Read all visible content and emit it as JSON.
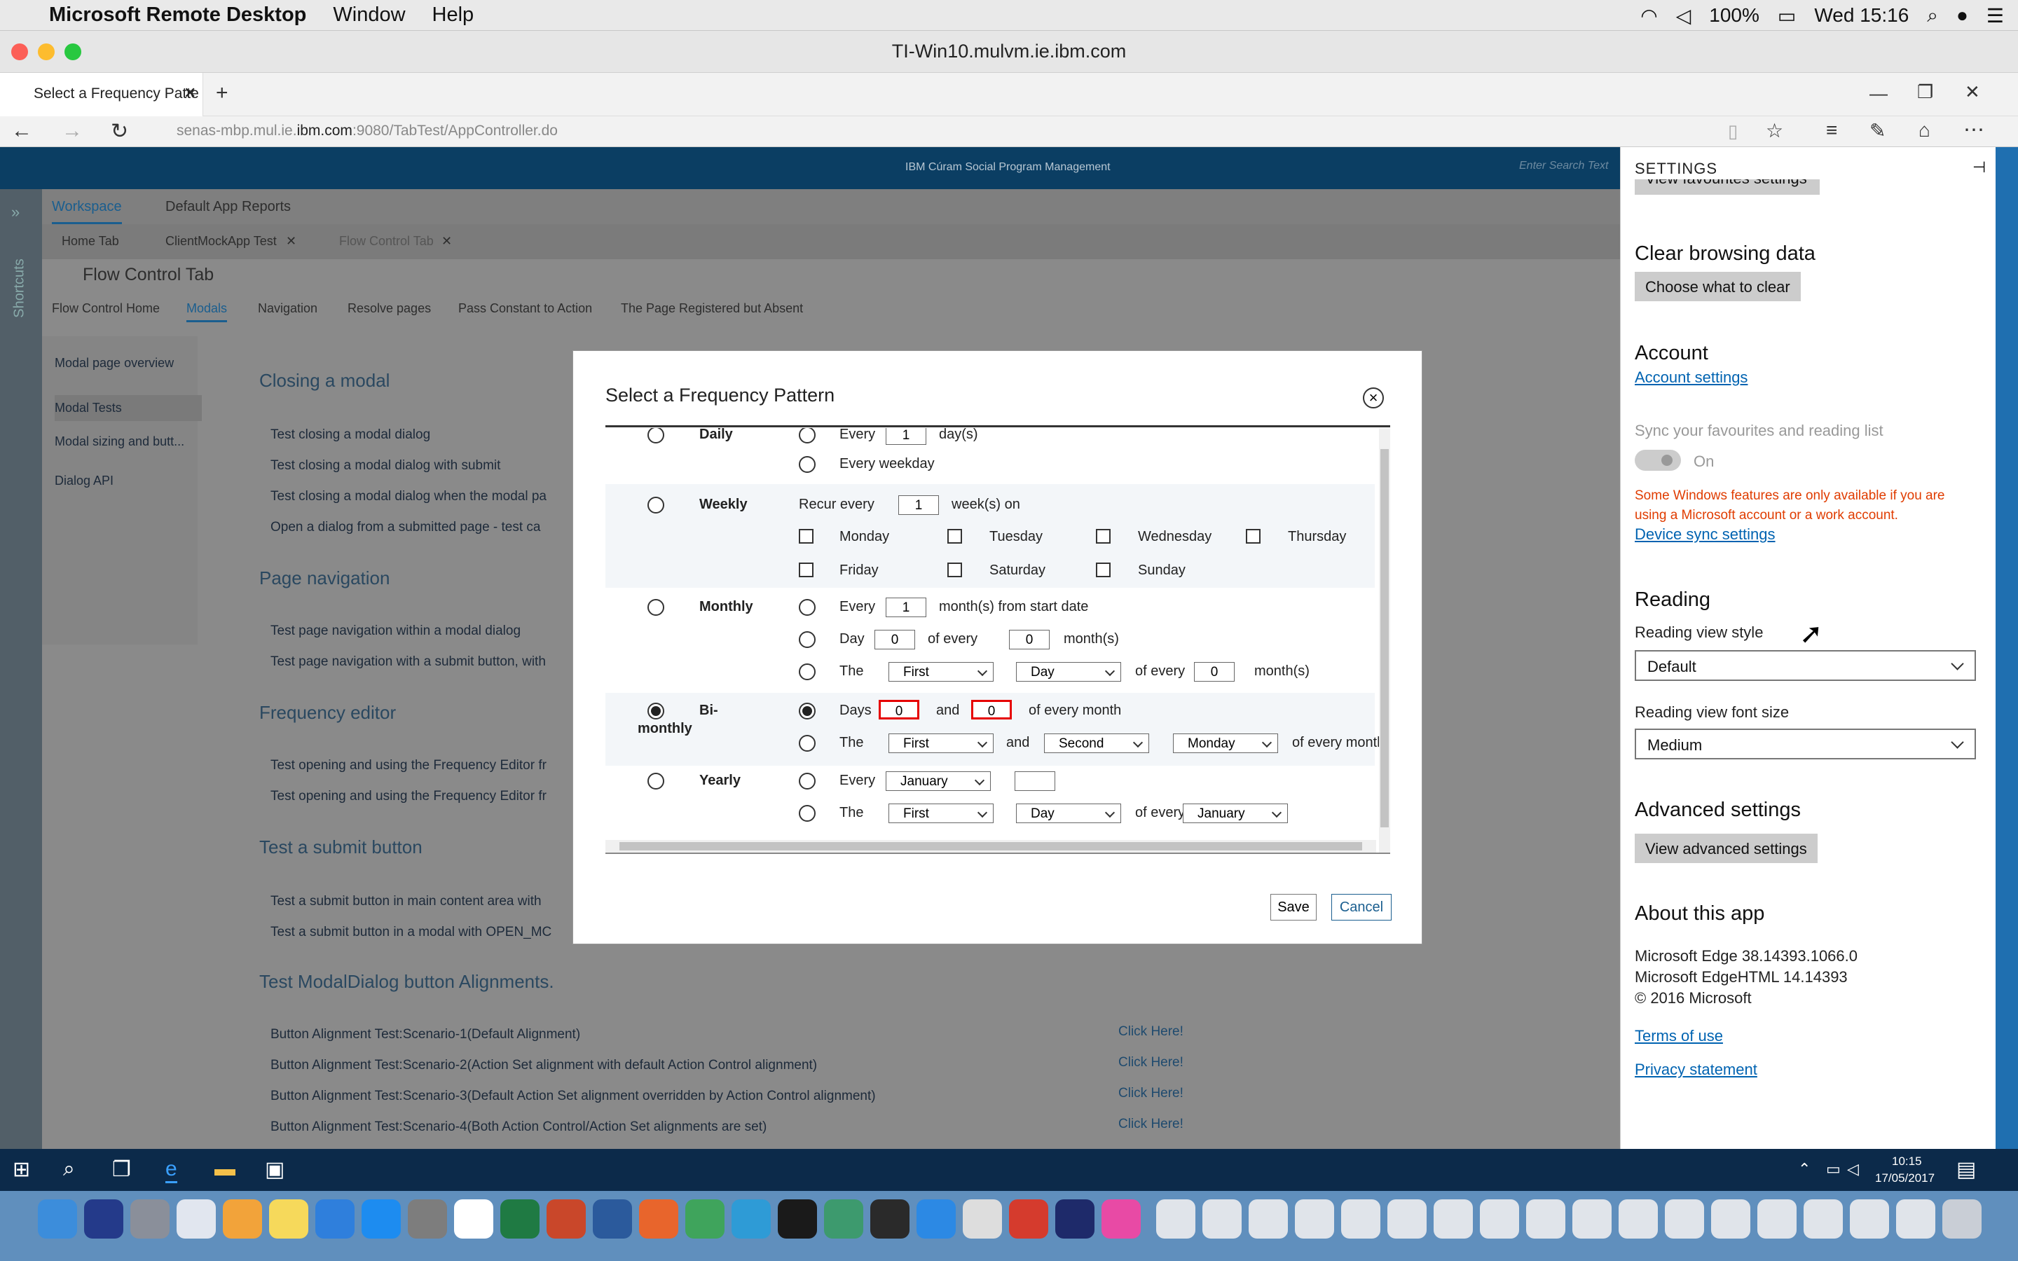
{
  "menubar": {
    "app": "Microsoft Remote Desktop",
    "menus": [
      "Window",
      "Help"
    ],
    "battery": "100%",
    "clock": "Wed 15:16"
  },
  "rdp": {
    "title": "TI-Win10.mulvm.ie.ibm.com"
  },
  "edge": {
    "tab_title": "Select a Frequency Patte",
    "url_prefix": "senas-mbp.mul.ie.",
    "url_domain": "ibm.com",
    "url_suffix": ":9080/TabTest/AppController.do"
  },
  "page": {
    "brand": "IBM Cúram Social Program Management",
    "search_placeholder": "Enter Search Text",
    "nav": [
      "Workspace",
      "Default App Reports"
    ],
    "tabs": [
      "Home Tab",
      "ClientMockApp Test",
      "Flow Control Tab"
    ],
    "shortcuts": "Shortcuts",
    "section_title": "Flow Control Tab",
    "subnav": [
      "Flow Control Home",
      "Modals",
      "Navigation",
      "Resolve pages",
      "Pass Constant to Action",
      "The Page Registered but Absent"
    ],
    "left_links": [
      "Modal page overview",
      "Modal Tests",
      "Modal sizing and butt...",
      "Dialog API"
    ],
    "headings": [
      "Closing a modal",
      "Page navigation",
      "Frequency editor",
      "Test a submit button",
      "Test ModalDialog button Alignments."
    ],
    "links_closing": [
      "Test closing a modal dialog",
      "Test closing a modal dialog with submit",
      "Test closing a modal dialog when the modal pa",
      "Open a dialog from a submitted page - test ca"
    ],
    "links_nav": [
      "Test page navigation within a modal dialog",
      "Test page navigation with a submit button, with"
    ],
    "links_freq": [
      "Test opening and using the Frequency Editor fr",
      "Test opening and using the Frequency Editor fr"
    ],
    "links_submit": [
      "Test a submit button in main content area with",
      "Test a submit button in a modal with OPEN_MC"
    ],
    "links_align": [
      "Button Alignment Test:Scenario-1(Default Alignment)",
      "Button Alignment Test:Scenario-2(Action Set alignment with default Action Control alignment)",
      "Button Alignment Test:Scenario-3(Default Action Set alignment overridden by Action Control alignment)",
      "Button Alignment Test:Scenario-4(Both Action Control/Action Set alignments are set)"
    ],
    "click_here": "Click Here!"
  },
  "modal": {
    "title": "Select a Frequency Pattern",
    "close": "×",
    "daily": {
      "label": "Daily",
      "every": "Every",
      "days_val": "1",
      "days_unit": "day(s)",
      "weekday": "Every weekday"
    },
    "weekly": {
      "label": "Weekly",
      "recur": "Recur every",
      "weeks_val": "1",
      "weeks_unit": "week(s) on",
      "days": [
        "Monday",
        "Tuesday",
        "Wednesday",
        "Thursday",
        "Friday",
        "Saturday",
        "Sunday"
      ]
    },
    "monthly": {
      "label": "Monthly",
      "every": "Every",
      "months_val": "1",
      "months_unit": "month(s) from start date",
      "day": "Day",
      "day_val": "0",
      "of_every": "of every",
      "of_every_val": "0",
      "months": "month(s)",
      "the": "The",
      "first": "First",
      "dayword": "Day",
      "the_val": "0"
    },
    "bimonthly": {
      "label1": "Bi-",
      "label2": "monthly",
      "days": "Days",
      "d1": "0",
      "and": "and",
      "d2": "0",
      "of_every_month": "of every month",
      "the": "The",
      "first": "First",
      "second": "Second",
      "monday": "Monday"
    },
    "yearly": {
      "label": "Yearly",
      "every": "Every",
      "month": "January",
      "the": "The",
      "first": "First",
      "dayword": "Day",
      "of_every": "of every",
      "month2": "January"
    },
    "save": "Save",
    "cancel": "Cancel"
  },
  "settings": {
    "title": "SETTINGS",
    "partial_button": "View favourites settings",
    "clear_heading": "Clear browsing data",
    "clear_button": "Choose what to clear",
    "account_heading": "Account",
    "account_link": "Account settings",
    "sync_label": "Sync your favourites and reading list",
    "sync_state": "On",
    "warning": "Some Windows features are only available if you are using a Microsoft account or a work account.",
    "device_sync": "Device sync settings",
    "reading_heading": "Reading",
    "reading_style_label": "Reading view style",
    "reading_style_value": "Default",
    "font_size_label": "Reading view font size",
    "font_size_value": "Medium",
    "advanced_heading": "Advanced settings",
    "advanced_button": "View advanced settings",
    "about_heading": "About this app",
    "about_lines": [
      "Microsoft Edge 38.14393.1066.0",
      "Microsoft EdgeHTML 14.14393",
      "© 2016 Microsoft"
    ],
    "terms": "Terms of use",
    "privacy": "Privacy statement"
  },
  "taskbar": {
    "time": "10:15",
    "date": "17/05/2017"
  }
}
